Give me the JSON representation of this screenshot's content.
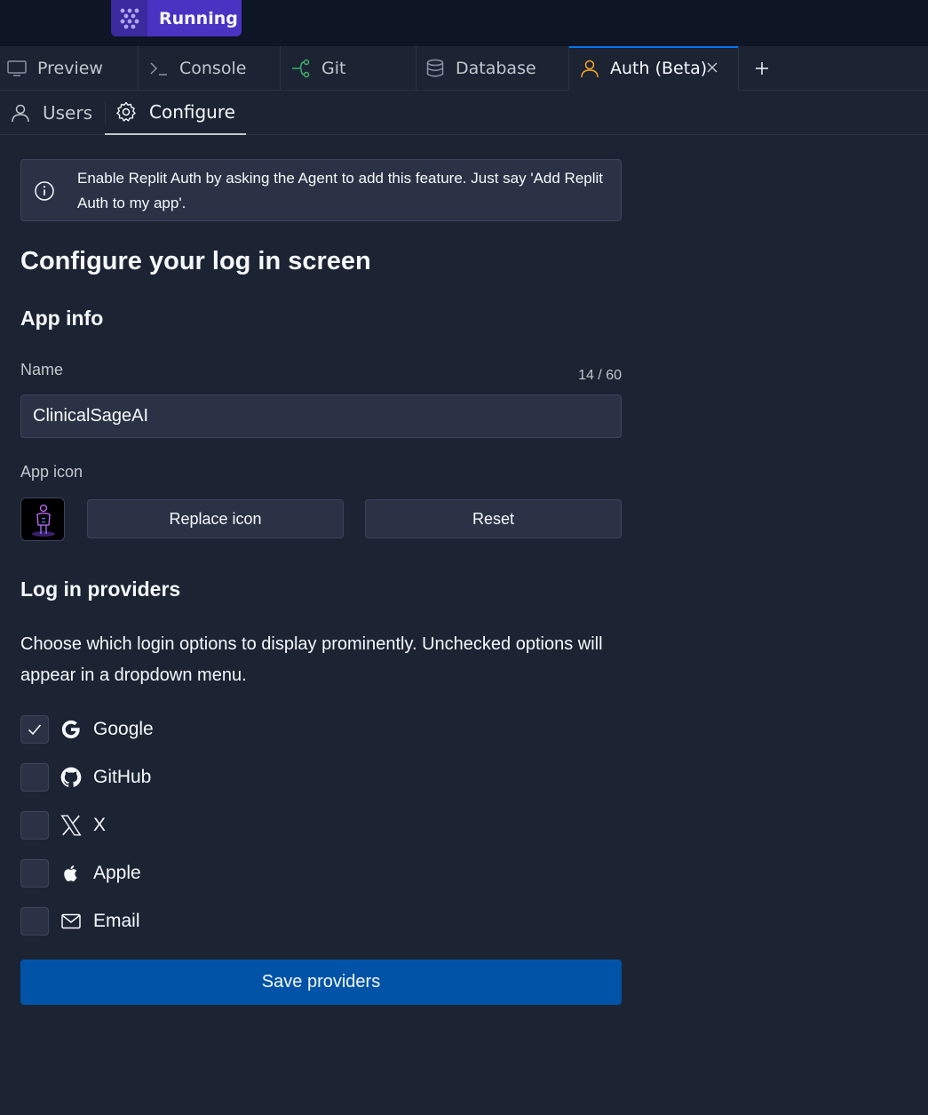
{
  "topbar": {
    "run_label": "Running"
  },
  "tabs": [
    {
      "label": "Preview",
      "icon": "monitor-icon"
    },
    {
      "label": "Console",
      "icon": "terminal-icon"
    },
    {
      "label": "Git",
      "icon": "git-branch-icon"
    },
    {
      "label": "Database",
      "icon": "database-icon"
    },
    {
      "label": "Auth (Beta)",
      "icon": "user-icon",
      "active": true
    }
  ],
  "subtabs": [
    {
      "label": "Users",
      "icon": "user-icon"
    },
    {
      "label": "Configure",
      "icon": "gear-icon",
      "active": true
    }
  ],
  "info": {
    "text": "Enable Replit Auth by asking the Agent to add this feature. Just say 'Add Replit Auth to my app'."
  },
  "page": {
    "title": "Configure your log in screen",
    "app_info_heading": "App info",
    "name_label": "Name",
    "name_counter": "14 / 60",
    "name_value": "ClinicalSageAI",
    "app_icon_label": "App icon",
    "replace_icon_label": "Replace icon",
    "reset_label": "Reset",
    "providers_heading": "Log in providers",
    "providers_desc": "Choose which login options to display prominently. Unchecked options will appear in a dropdown menu.",
    "save_label": "Save providers"
  },
  "providers": [
    {
      "label": "Google",
      "icon": "google-icon",
      "checked": true
    },
    {
      "label": "GitHub",
      "icon": "github-icon",
      "checked": false
    },
    {
      "label": "X",
      "icon": "x-icon",
      "checked": false
    },
    {
      "label": "Apple",
      "icon": "apple-icon",
      "checked": false
    },
    {
      "label": "Email",
      "icon": "mail-icon",
      "checked": false
    }
  ],
  "colors": {
    "accent": "#0053a6",
    "run": "#4a33c3",
    "auth_icon": "#f5a623"
  }
}
